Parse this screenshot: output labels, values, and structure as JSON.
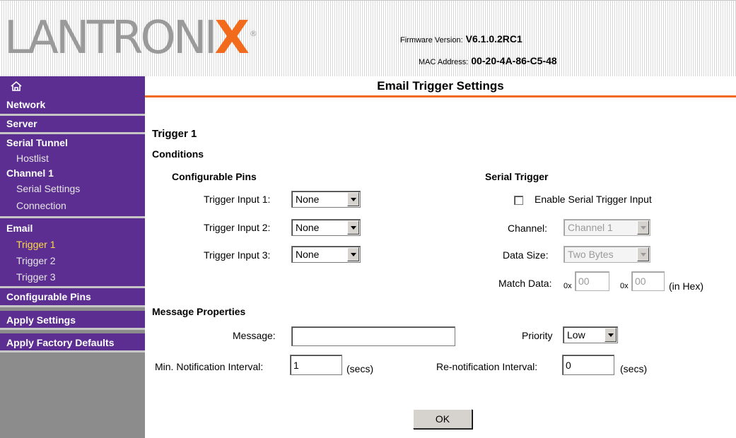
{
  "header": {
    "logo_text": "LANTRONI",
    "logo_x": "X",
    "logo_mark": "®",
    "firmware_label": "Firmware Version:",
    "firmware_value": "V6.1.0.2RC1",
    "mac_label": "MAC Address:",
    "mac_value": "00-20-4A-86-C5-48"
  },
  "colors": {
    "brand_purple": "#5c2e91",
    "brand_orange": "#f26a1b",
    "active_item": "#ffd84a"
  },
  "sidebar": {
    "home_icon": "home-icon",
    "network": "Network",
    "server": "Server",
    "serial_tunnel": "Serial Tunnel",
    "hostlist": "Hostlist",
    "channel1": "Channel 1",
    "serial_settings": "Serial Settings",
    "connection": "Connection",
    "email": "Email",
    "trigger1": "Trigger 1",
    "trigger2": "Trigger 2",
    "trigger3": "Trigger 3",
    "configurable_pins": "Configurable Pins",
    "apply_settings": "Apply Settings",
    "apply_factory_defaults": "Apply Factory Defaults"
  },
  "page": {
    "title": "Email Trigger Settings",
    "trigger_heading": "Trigger 1",
    "conditions": "Conditions",
    "configurable_pins": {
      "heading": "Configurable Pins",
      "input1_label": "Trigger Input 1:",
      "input1_value": "None",
      "input2_label": "Trigger Input 2:",
      "input2_value": "None",
      "input3_label": "Trigger Input 3:",
      "input3_value": "None"
    },
    "serial_trigger": {
      "heading": "Serial Trigger",
      "enable_label": "Enable Serial Trigger Input",
      "enabled": false,
      "channel_label": "Channel:",
      "channel_value": "Channel 1",
      "data_size_label": "Data Size:",
      "data_size_value": "Two Bytes",
      "match_label": "Match Data:",
      "prefix1": "0x",
      "match1": "00",
      "prefix2": "0x",
      "match2": "00",
      "hex_note": "(in Hex)"
    },
    "message_properties": {
      "heading": "Message Properties",
      "message_label": "Message:",
      "message_value": "",
      "priority_label": "Priority",
      "priority_value": "Low",
      "min_interval_label": "Min. Notification Interval:",
      "min_interval_value": "1",
      "min_interval_unit": "(secs)",
      "renotify_label": "Re-notification Interval:",
      "renotify_value": "0",
      "renotify_unit": "(secs)"
    },
    "ok_label": "OK"
  }
}
